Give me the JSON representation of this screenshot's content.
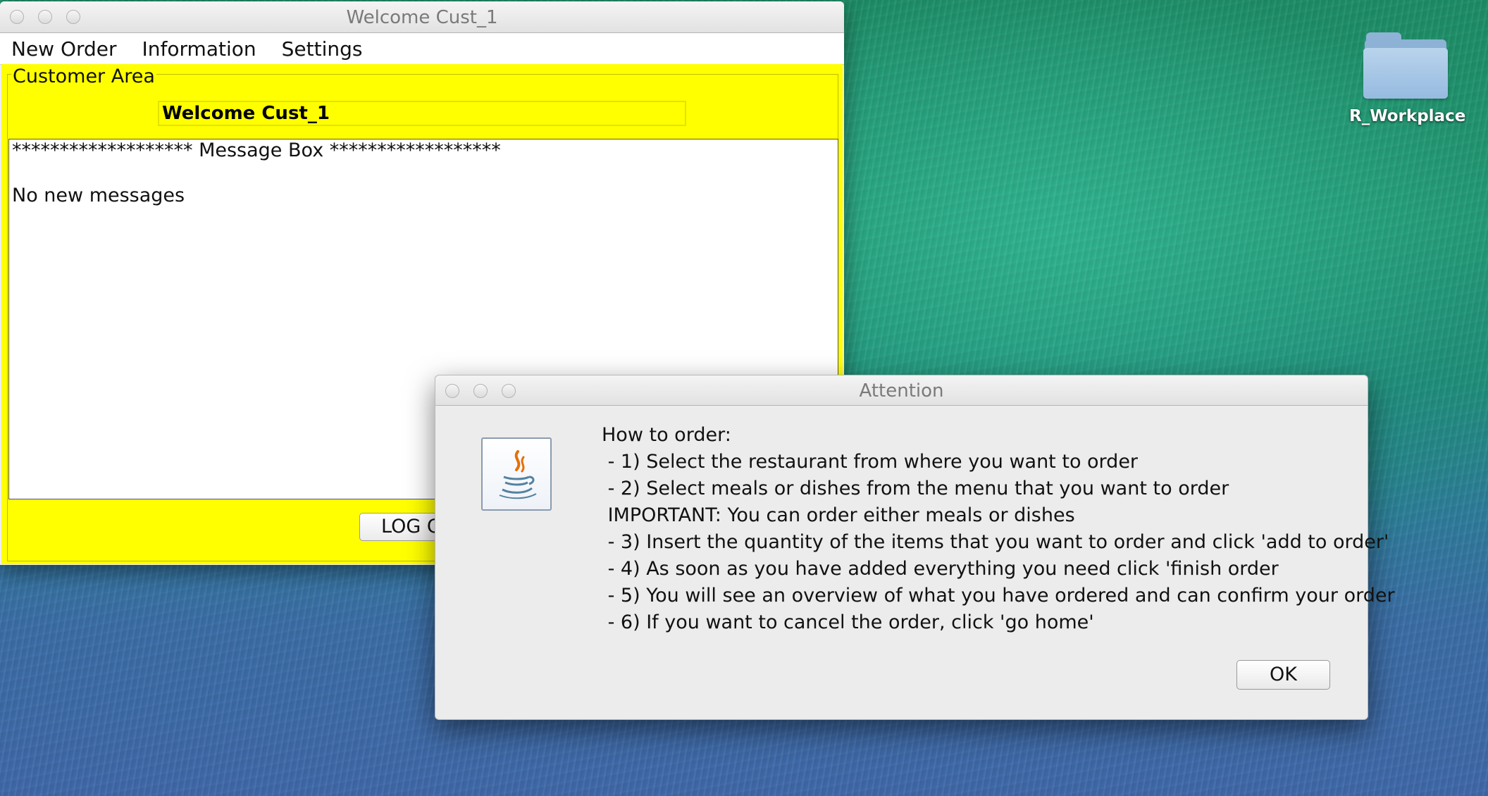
{
  "desktop": {
    "folder_label": "R_Workplace"
  },
  "main_window": {
    "title": "Welcome Cust_1",
    "menu": [
      "New Order",
      "Information",
      "Settings"
    ],
    "group_title": "Customer Area",
    "welcome_field": "Welcome Cust_1",
    "message_box": {
      "header": "******************* Message Box ******************",
      "text": "No new messages"
    },
    "logout_button": "LOG OUT"
  },
  "dialog": {
    "title": "Attention",
    "lines": [
      "How to order:",
      " - 1) Select the restaurant from where you want to order",
      " - 2) Select meals or dishes from the menu that you want to order",
      " IMPORTANT: You can order either meals or dishes",
      " - 3) Insert the quantity of the items that you want to order and click 'add to order'",
      " - 4) As soon as you have added everything you need click 'finish order",
      " - 5) You will see an overview of what you have ordered and can confirm your order",
      " - 6) If you want to cancel the order, click 'go home'"
    ],
    "ok_button": "OK"
  },
  "icons": [
    "close-icon",
    "minimize-icon",
    "zoom-icon",
    "java-icon",
    "folder-icon"
  ]
}
